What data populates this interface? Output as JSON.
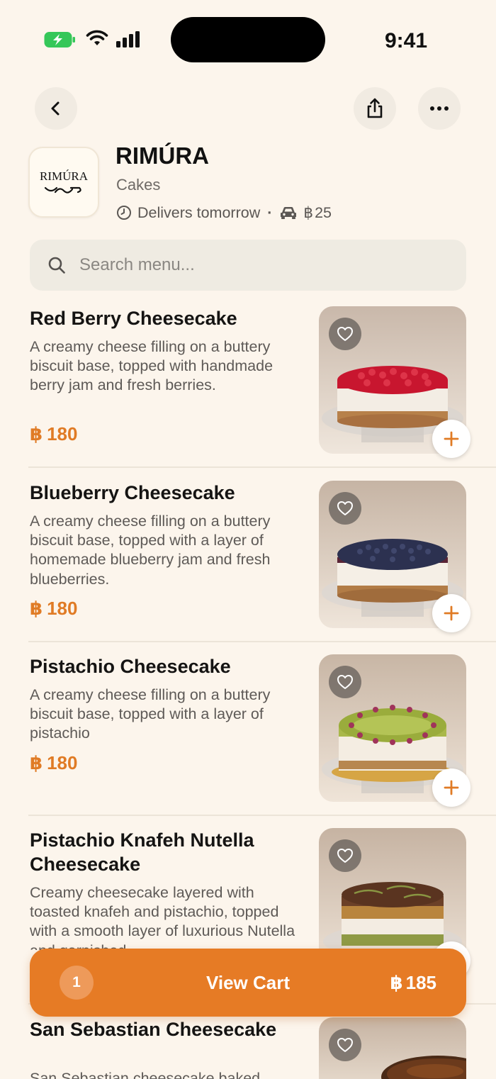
{
  "status_bar": {
    "time": "9:41"
  },
  "header": {
    "back_icon": "chevron-left-icon",
    "share_icon": "share-icon",
    "more_icon": "ellipsis-icon"
  },
  "restaurant": {
    "name": "RIMÚRA",
    "logo_text": "RIMÚRA",
    "category": "Cakes",
    "delivery_text": "Delivers tomorrow",
    "separator": "·",
    "currency_symbol": "฿",
    "delivery_fee": "25"
  },
  "search": {
    "placeholder": "Search menu..."
  },
  "menu": {
    "currency_symbol": "฿",
    "items": [
      {
        "title": "Red Berry Cheesecake",
        "description": "A creamy cheese filling on a buttery biscuit base, topped with handmade berry jam and fresh berries.",
        "price": "180",
        "topping_color": "#c8162f"
      },
      {
        "title": "Blueberry Cheesecake",
        "description": "A creamy cheese filling on a buttery biscuit base, topped with a layer of homemade blueberry jam and fresh blueberries.",
        "price": "180",
        "topping_color": "#2c3150"
      },
      {
        "title": "Pistachio Cheesecake",
        "description": "A creamy cheese filling on a buttery biscuit base, topped with a layer of pistachio",
        "price": "180",
        "topping_color": "#9aac3c"
      },
      {
        "title": "Pistachio Knafeh Nutella Cheesecake",
        "description": "Creamy cheesecake layered with toasted knafeh and pistachio, topped with a smooth layer of luxurious Nutella and garnished",
        "price": "",
        "topping_color": "#6b4028"
      },
      {
        "title": "San Sebastian Cheesecake",
        "description": "San Sebastian cheesecake baked",
        "price": "",
        "topping_color": "#4a2a16"
      }
    ]
  },
  "cart": {
    "count": "1",
    "label": "View Cart",
    "currency_symbol": "฿",
    "total": "185"
  },
  "colors": {
    "background": "#fcf5ec",
    "accent": "#e67b25",
    "price": "#e07b25"
  }
}
